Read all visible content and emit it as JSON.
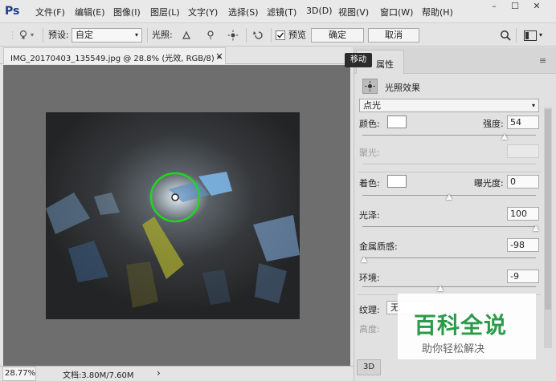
{
  "app": {
    "logo": "Ps"
  },
  "menu": [
    "文件(F)",
    "编辑(E)",
    "图像(I)",
    "图层(L)",
    "文字(Y)",
    "选择(S)",
    "滤镜(T)",
    "3D(D)",
    "视图(V)",
    "窗口(W)",
    "帮助(H)"
  ],
  "window_controls": {
    "minimize": "–",
    "maximize": "☐",
    "close": "✕"
  },
  "options": {
    "preset_label": "预设:",
    "preset_value": "自定",
    "light_label": "光照:",
    "preview_label": "预览",
    "ok_label": "确定",
    "cancel_label": "取消"
  },
  "document": {
    "tab_title": "IMG_20170403_135549.jpg @ 28.8% (光效, RGB/8) *",
    "tab_close": "×"
  },
  "status": {
    "zoom": "28.77%",
    "doc_info": "文档:3.80M/7.60M",
    "arrow": "›"
  },
  "panel": {
    "tooltip": "移动",
    "tab_title": "属性",
    "heading": "光照效果",
    "light_type": "点光",
    "color_label": "颜色:",
    "intensity_label": "强度:",
    "intensity_value": "54",
    "intensity_level": 0.82,
    "hotspot_label": "聚光:",
    "colorize_label": "着色:",
    "exposure_label": "曝光度:",
    "exposure_value": "0",
    "exposure_level": 0.5,
    "gloss_label": "光泽:",
    "gloss_value": "100",
    "gloss_level": 1.0,
    "metallic_label": "金属质感:",
    "metallic_value": "-98",
    "metallic_level": 0.01,
    "ambience_label": "环境:",
    "ambience_value": "-9",
    "ambience_level": 0.45,
    "texture_label": "纹理:",
    "texture_value": "无",
    "height_label": "高度:",
    "bottom_tab": "3D"
  },
  "watermark": {
    "title": "百科全说",
    "subtitle": "助你轻松解决"
  },
  "colors": {
    "accent": "#1a3c8f",
    "light_ring": "#22d522",
    "watermark_green": "#2b9b4a"
  }
}
